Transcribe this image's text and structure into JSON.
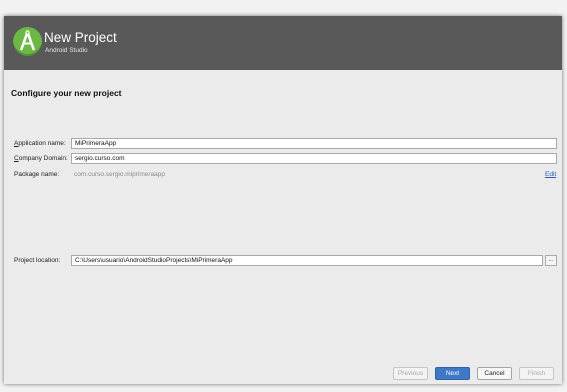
{
  "window": {
    "title": "New Project",
    "subtitle": "Android Studio"
  },
  "page": {
    "heading": "Configure your new project"
  },
  "form": {
    "application_name": {
      "label_prefix": "A",
      "label_rest": "pplication name:",
      "value": "MiPrimeraApp"
    },
    "company_domain": {
      "label_prefix": "C",
      "label_rest": "ompany Domain:",
      "value": "sergio.curso.com"
    },
    "package_name": {
      "label": "Package name:",
      "value": "com.curso.sergio.miprimeraapp",
      "edit_label": "Edit"
    },
    "project_location": {
      "label": "Project location:",
      "value": "C:\\Users\\usuario\\AndroidStudioProjects\\MiPrimeraApp",
      "browse_label": "..."
    }
  },
  "buttons": {
    "previous": "Previous",
    "next": "Next",
    "cancel": "Cancel",
    "finish": "Finish"
  },
  "colors": {
    "header_bg": "#595959",
    "logo_green": "#6bb844",
    "primary_button": "#3f78c5",
    "link": "#2b5db8"
  },
  "icons": {
    "logo": "android-studio-logo-icon"
  }
}
